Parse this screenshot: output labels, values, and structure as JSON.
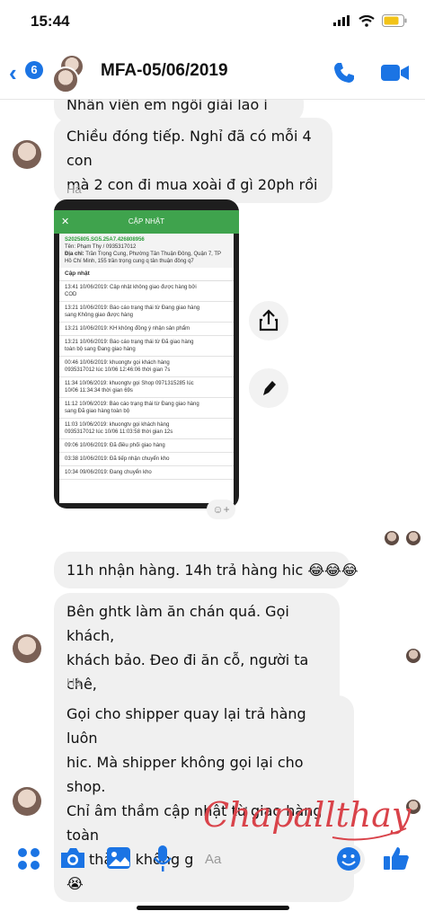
{
  "status": {
    "time": "15:44"
  },
  "header": {
    "back_badge": "6",
    "title": "MFA-05/06/2019"
  },
  "messages": {
    "partial_top": "Nhân viên em ngồi giải lao i",
    "m1": "Chiều đóng tiếp. Nghỉ đã có mỗi 4 con\nmà 2 con đi mua xoài đ gì 20ph rồi",
    "sender1": "Hà",
    "m2": "11h nhận hàng. 14h trả hàng hic 😂😂😂",
    "m3": "Bên ghtk làm ăn chán quá. Gọi khách,\nkhách bảo. Đeo đi ăn cỗ, người ta chê,\nnên mình trả lại. Không nhận nữa",
    "sender2": "Hà",
    "m4": "Gọi cho shipper quay lại trả hàng luôn\nhic. Mà shipper không gọi lại cho shop.\nChỉ âm thầm cập nhật từ giao hàng toàn\nbộ thành không giao được hàng 😁😁\n😭"
  },
  "card": {
    "title": "CẬP NHẬT",
    "code": "S2025805.SG5.25A7.426808956",
    "name_line": "Tên: Phạm Thy / 0935317012",
    "address_label": "Địa chỉ:",
    "address": "Trần Trọng Cung, Phường Tân Thuận Đông, Quận 7, TP Hồ Chí Minh, 155 trần trọng cung q tân thuận đông q7",
    "section": "Cập nhật",
    "updates": [
      "13:41 10/06/2019: Cập nhật không giao được hàng bởi\nCOD",
      "13:21 10/06/2019: Báo cáo trạng thái từ Đang giao hàng\nsang Không giao được hàng",
      "13:21 10/06/2019: KH không đồng ý nhận sản phẩm",
      "13:21 10/06/2019: Báo cáo trạng thái từ Đã giao hàng\ntoàn bộ sang Đang giao hàng",
      "00:46 10/06/2019: khuongtv gọi khách hàng\n0935317012 lúc 10/06 12:46:06 thời gian 7s",
      "11:34 10/06/2019: khuongtv gọi Shop 0971315285 lúc\n10/06 11:34:34 thời gian 69s",
      "11:12 10/06/2019: Báo cáo trạng thái từ Đang giao hàng\nsang Đã giao hàng toàn bộ",
      "11:03 10/06/2019: khuongtv gọi khách hàng\n0935317012 lúc 10/06 11:03:58 thời gian 12s",
      "09:06 10/06/2019: Đã điều phối giao hàng",
      "03:38 10/06/2019: Đã tiếp nhận chuyển kho",
      "10:34 09/06/2019: Đang chuyển kho"
    ]
  },
  "composer": {
    "placeholder": "Aa"
  },
  "overlay": {
    "signature": "Chapallthay"
  }
}
